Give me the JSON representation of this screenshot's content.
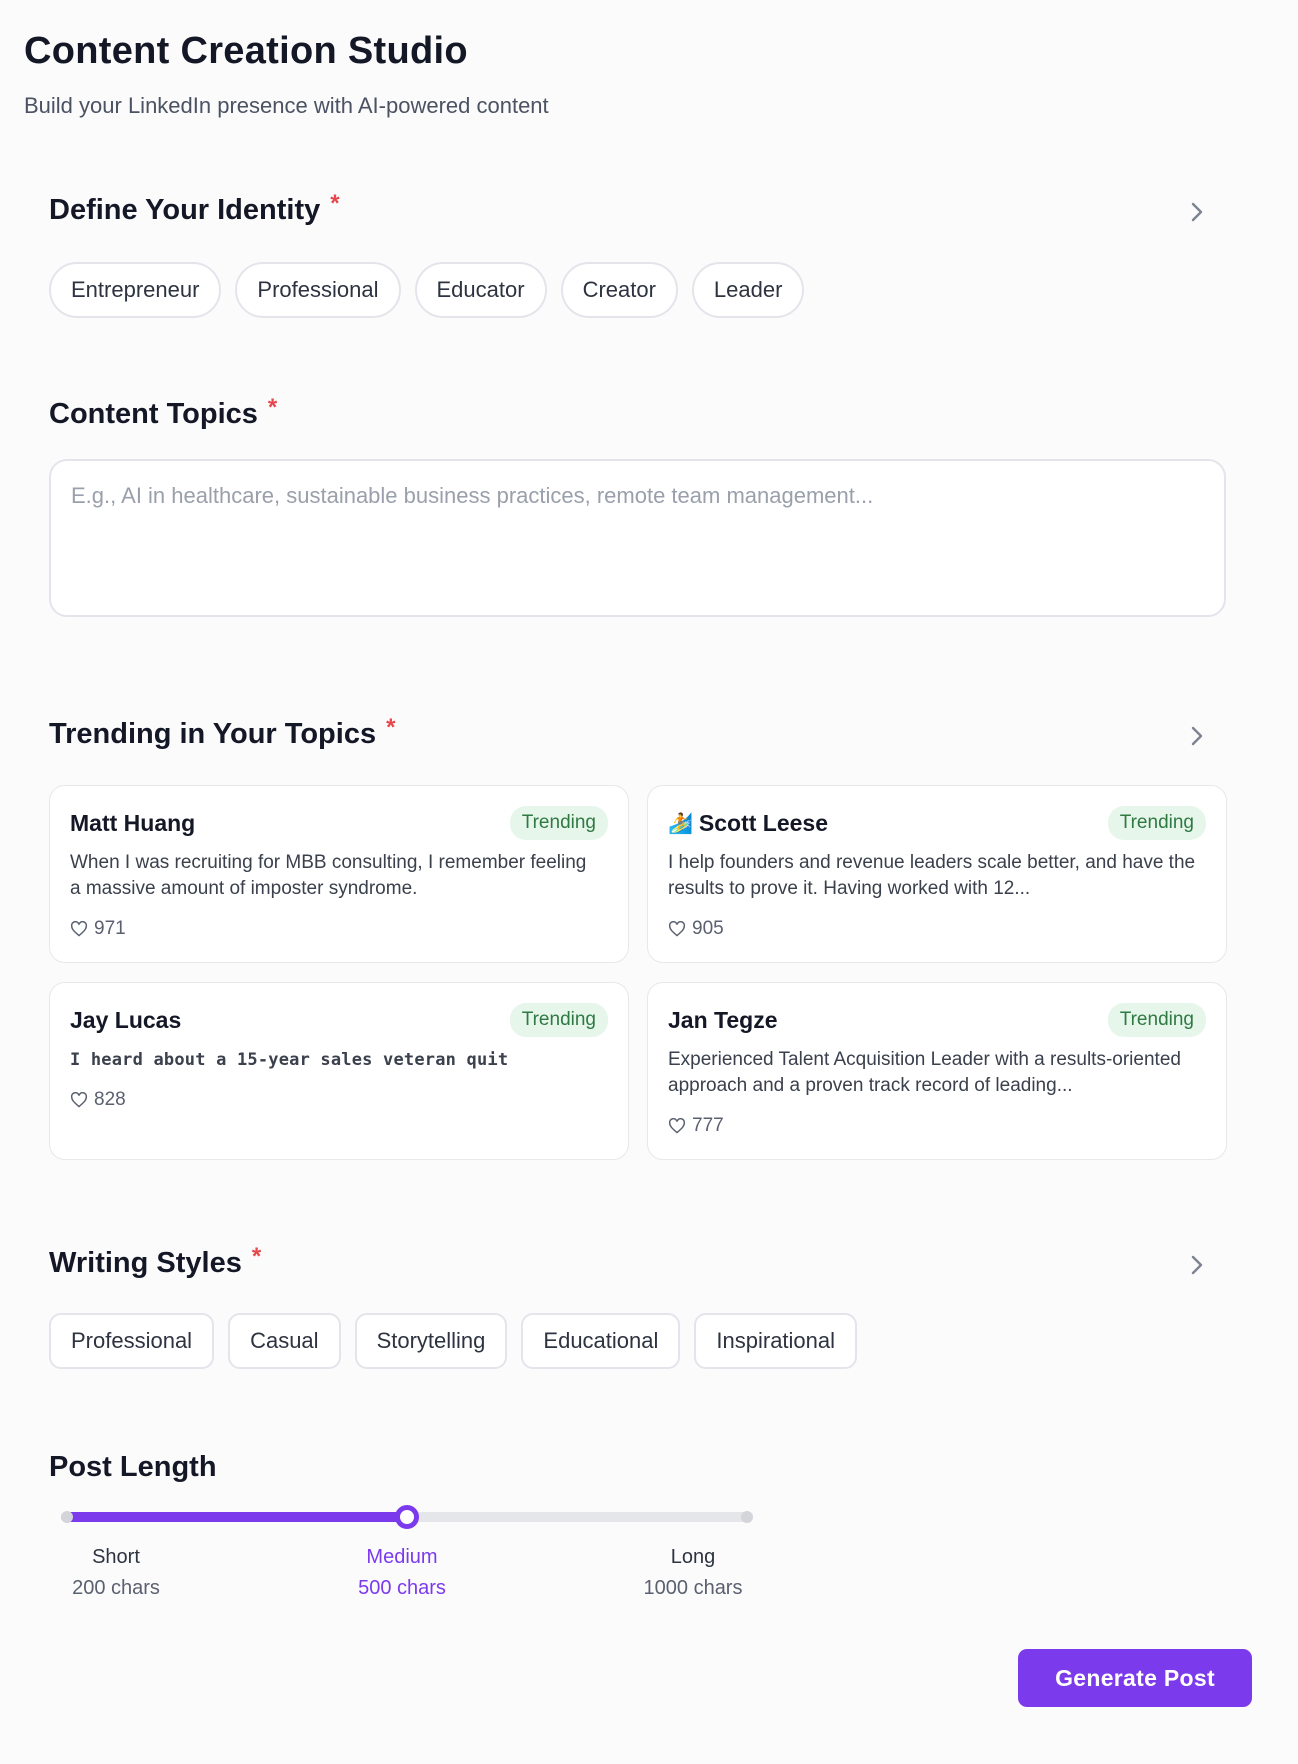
{
  "header": {
    "title": "Content Creation Studio",
    "subtitle": "Build your LinkedIn presence with AI-powered content"
  },
  "identity": {
    "title": "Define Your Identity",
    "required": "*",
    "options": [
      "Entrepreneur",
      "Professional",
      "Educator",
      "Creator",
      "Leader"
    ]
  },
  "topics": {
    "title": "Content Topics",
    "required": "*",
    "placeholder": "E.g., AI in healthcare, sustainable business practices, remote team management...",
    "value": ""
  },
  "trending": {
    "title": "Trending in Your Topics",
    "required": "*",
    "cards": [
      {
        "name": "Matt Huang",
        "emoji": "",
        "badge": "Trending",
        "text": "When I was recruiting for MBB consulting, I remember feeling a massive amount of imposter syndrome.",
        "likes": "971"
      },
      {
        "name": "Scott Leese",
        "emoji": "🏄",
        "badge": "Trending",
        "text": "I help founders and revenue leaders scale better, and have the results to prove it. Having worked with 12...",
        "likes": "905"
      },
      {
        "name": "Jay Lucas",
        "emoji": "",
        "badge": "Trending",
        "text": "I heard about a 15-year sales veteran quit",
        "likes": "828"
      },
      {
        "name": "Jan Tegze",
        "emoji": "",
        "badge": "Trending",
        "text": "Experienced Talent Acquisition Leader with a results-oriented approach and a proven track record of leading...",
        "likes": "777"
      }
    ]
  },
  "styles": {
    "title": "Writing Styles",
    "required": "*",
    "options": [
      "Professional",
      "Casual",
      "Storytelling",
      "Educational",
      "Inspirational"
    ]
  },
  "post_length": {
    "title": "Post Length",
    "selected_fraction": 0.5,
    "options": [
      {
        "name": "Short",
        "chars": "200 chars"
      },
      {
        "name": "Medium",
        "chars": "500 chars"
      },
      {
        "name": "Long",
        "chars": "1000 chars"
      }
    ]
  },
  "actions": {
    "generate_label": "Generate Post"
  },
  "colors": {
    "accent": "#7c3aed",
    "required": "#e5484d",
    "trending_bg": "#e6f6ea",
    "trending_text": "#2f7a43"
  }
}
